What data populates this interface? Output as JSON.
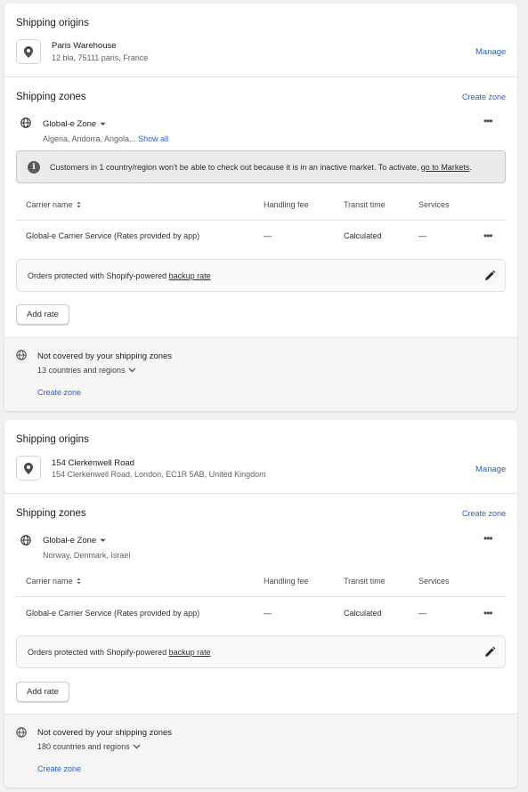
{
  "cards": [
    {
      "origins_title": "Shipping origins",
      "location_name": "Paris Warehouse",
      "location_address": "12 bla, 75111 paris, France",
      "manage_label": "Manage",
      "zones_title": "Shipping zones",
      "create_zone_label": "Create zone",
      "zone_name": "Global-e Zone",
      "zone_countries": "Algeria, Andorra, Angola...",
      "show_all_label": "Show all",
      "banner_text": "Customers in 1 country/region won't be able to check out because it is in an inactive market. To activate,",
      "banner_link": "go to Markets",
      "banner_end": ".",
      "columns": {
        "carrier": "Carrier name",
        "handling": "Handling fee",
        "transit": "Transit time",
        "services": "Services"
      },
      "rate": {
        "carrier": "Global-e Carrier Service (Rates provided by app)",
        "handling": "—",
        "transit": "Calculated",
        "services": "—"
      },
      "backup_text": "Orders protected with Shopify-powered",
      "backup_link": "backup rate",
      "add_rate_label": "Add rate",
      "not_covered_title": "Not covered by your shipping zones",
      "not_covered_count": "13 countries and regions",
      "footer_create_zone": "Create zone"
    },
    {
      "origins_title": "Shipping origins",
      "location_name": "154 Clerkenwell Road",
      "location_address": "154 Clerkenwell Road, London, EC1R 5AB, United Kingdom",
      "manage_label": "Manage",
      "zones_title": "Shipping zones",
      "create_zone_label": "Create zone",
      "zone_name": "Global-e Zone",
      "zone_countries": "Norway, Denmark, Israel",
      "columns": {
        "carrier": "Carrier name",
        "handling": "Handling fee",
        "transit": "Transit time",
        "services": "Services"
      },
      "rate": {
        "carrier": "Global-e Carrier Service (Rates provided by app)",
        "handling": "—",
        "transit": "Calculated",
        "services": "—"
      },
      "backup_text": "Orders protected with Shopify-powered",
      "backup_link": "backup rate",
      "add_rate_label": "Add rate",
      "not_covered_title": "Not covered by your shipping zones",
      "not_covered_count": "180 countries and regions",
      "footer_create_zone": "Create zone"
    }
  ],
  "icons": {
    "location": "location-pin-icon",
    "globe": "globe-icon",
    "info": "info-icon",
    "sort": "sort-icon",
    "more": "more-horizontal-icon",
    "edit": "pencil-icon",
    "chevron": "chevron-down-icon",
    "caret": "caret-down-icon"
  },
  "colors": {
    "link": "#2c5fbf",
    "banner_bg": "#ebebeb",
    "footer_bg": "#f6f6f6"
  }
}
